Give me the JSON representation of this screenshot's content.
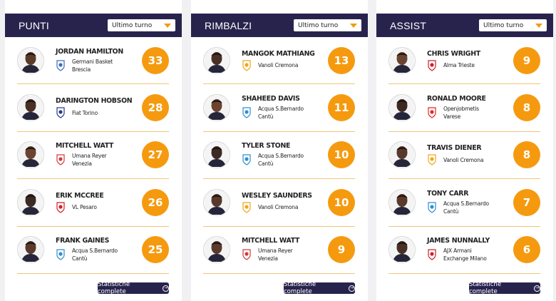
{
  "footer_label": "Statistiche complete",
  "filter_label": "Ultimo turno",
  "colors": {
    "header": "#28234d",
    "accent": "#f59a0f",
    "divider": "#f0c679"
  },
  "panels": [
    {
      "title": "PUNTI",
      "players": [
        {
          "name": "JORDAN HAMILTON",
          "team": "Germani Basket\nBrescia",
          "value": "33",
          "logo": "brescia-logo",
          "logo_color": "#3a6fb6"
        },
        {
          "name": "DARINGTON HOBSON",
          "team": "Fiat Torino",
          "value": "28",
          "logo": "torino-logo",
          "logo_color": "#2a3b8c"
        },
        {
          "name": "MITCHELL WATT",
          "team": "Umana Reyer\nVenezia",
          "value": "27",
          "logo": "venezia-logo",
          "logo_color": "#d33b3b"
        },
        {
          "name": "ERIK MCCREE",
          "team": "VL Pesaro",
          "value": "26",
          "logo": "pesaro-logo",
          "logo_color": "#d61f26"
        },
        {
          "name": "FRANK GAINES",
          "team": "Acqua S.Bernardo\nCantù",
          "value": "25",
          "logo": "cantu-logo",
          "logo_color": "#2f8fd0"
        }
      ]
    },
    {
      "title": "RIMBALZI",
      "players": [
        {
          "name": "MANGOK MATHIANG",
          "team": "Vanoli Cremona",
          "value": "13",
          "logo": "cremona-logo",
          "logo_color": "#f0a71a"
        },
        {
          "name": "SHAHEED DAVIS",
          "team": "Acqua S.Bernardo\nCantù",
          "value": "11",
          "logo": "cantu-logo",
          "logo_color": "#2f8fd0"
        },
        {
          "name": "TYLER STONE",
          "team": "Acqua S.Bernardo\nCantù",
          "value": "10",
          "logo": "cantu-logo",
          "logo_color": "#2f8fd0"
        },
        {
          "name": "WESLEY SAUNDERS",
          "team": "Vanoli Cremona",
          "value": "10",
          "logo": "cremona-logo",
          "logo_color": "#f0a71a"
        },
        {
          "name": "MITCHELL WATT",
          "team": "Umana Reyer\nVenezia",
          "value": "9",
          "logo": "venezia-logo",
          "logo_color": "#d33b3b"
        }
      ]
    },
    {
      "title": "ASSIST",
      "players": [
        {
          "name": "CHRIS WRIGHT",
          "team": "Alma Trieste",
          "value": "9",
          "logo": "trieste-logo",
          "logo_color": "#c8202f"
        },
        {
          "name": "RONALD MOORE",
          "team": "Openjobmetis\nVarese",
          "value": "8",
          "logo": "varese-logo",
          "logo_color": "#e0262e"
        },
        {
          "name": "TRAVIS DIENER",
          "team": "Vanoli Cremona",
          "value": "8",
          "logo": "cremona-logo",
          "logo_color": "#f0a71a"
        },
        {
          "name": "TONY CARR",
          "team": "Acqua S.Bernardo\nCantù",
          "value": "7",
          "logo": "cantu-logo",
          "logo_color": "#2f8fd0"
        },
        {
          "name": "JAMES NUNNALLY",
          "team": "AJX Armani\nExchange Milano",
          "value": "6",
          "logo": "milano-logo",
          "logo_color": "#c8202f"
        }
      ]
    }
  ]
}
